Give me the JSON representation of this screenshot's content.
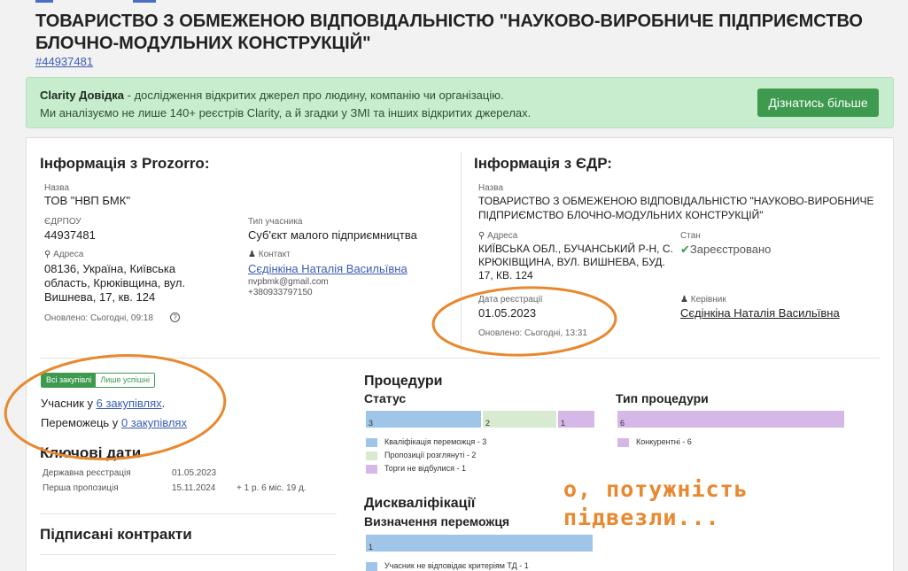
{
  "company": {
    "title": "ТОВАРИСТВО З ОБМЕЖЕНОЮ ВІДПОВІДАЛЬНІСТЮ \"НАУКОВО-ВИРОБНИЧЕ ПІДПРИЄМСТВО БЛОЧНО-МОДУЛЬНИХ КОНСТРУКЦІЙ\"",
    "id_link": "#44937481"
  },
  "banner": {
    "brand": "Clarity Довідка",
    "line1": " - дослідження відкритих джерел про людину, компанію чи організацію.",
    "line2": "Ми аналізуємо не лише 140+ реєстрів Clarity, а й згадки у ЗМІ та інших відкритих джерелах.",
    "button": "Дізнатись більше",
    "bg_color": "#c8ecce",
    "button_color": "#3d9a4e"
  },
  "prozorro": {
    "heading": "Інформація з Prozorro:",
    "name_label": "Назва",
    "name": "ТОВ \"НВП БМК\"",
    "edrpou_label": "ЄДРПОУ",
    "edrpou": "44937481",
    "participant_type_label": "Тип учасника",
    "participant_type": "Суб'єкт малого підприємництва",
    "address_label": "Адреса",
    "address": "08136, Україна, Київська область, Крюківщина, вул. Вишнева, 17, кв. 124",
    "contact_label": "Контакт",
    "contact_name": "Сєдінкіна Наталія Васильївна",
    "contact_email": "nvpbmk@gmail.com",
    "contact_phone": "+380933797150",
    "updated": "Оновлено: Сьогодні, 09:18",
    "help_icon": "question-circle-icon"
  },
  "edr": {
    "heading": "Інформація з ЄДР:",
    "name_label": "Назва",
    "name": "ТОВАРИСТВО З ОБМЕЖЕНОЮ ВІДПОВІДАЛЬНІСТЮ \"НАУКОВО-ВИРОБНИЧЕ ПІДПРИЄМСТВО БЛОЧНО-МОДУЛЬНИХ КОНСТРУКЦІЙ\"",
    "address_label": "Адреса",
    "address": "КИЇВСЬКА ОБЛ., БУЧАНСЬКИЙ Р-Н, С. КРЮКІВЩИНА, ВУЛ. ВИШНЕВА, БУД. 17, КВ. 124",
    "status_label": "Стан",
    "status": "Зареєстровано",
    "reg_date_label": "Дата реєстрації",
    "reg_date": "01.05.2023",
    "head_label": "Керівник",
    "head_name": "Сєдінкіна Наталія Васильївна",
    "updated": "Оновлено: Сьогодні, 13:31"
  },
  "purchases": {
    "toggle_all": "Всі закупівлі",
    "toggle_success": "Лише успішні",
    "participant_prefix": "Учасник у ",
    "participant_link": "6 закупівлях",
    "participant_suffix": ".",
    "winner_prefix": "Переможець у ",
    "winner_link": "0 закупівлях"
  },
  "key_dates": {
    "heading": "Ключові дати",
    "rows": [
      {
        "label": "Державна реєстрація",
        "value": "01.05.2023",
        "extra": ""
      },
      {
        "label": "Перша пропозиція",
        "value": "15.11.2024",
        "extra": "+ 1 р. 6 міс. 19 д."
      }
    ]
  },
  "contracts": {
    "heading": "Підписані контракти"
  },
  "procedures": {
    "heading": "Процедури",
    "status_title": "Статус",
    "status_bars": [
      {
        "value": "3",
        "color": "#9fc5e8"
      },
      {
        "value": "2",
        "color": "#d9ead3"
      },
      {
        "value": "1",
        "color": "#d5b8e8"
      }
    ],
    "status_legend": [
      {
        "label": "Кваліфікація переможця - 3",
        "color": "#9fc5e8"
      },
      {
        "label": "Пропозиції розглянуті - 2",
        "color": "#d9ead3"
      },
      {
        "label": "Торги не відбулися - 1",
        "color": "#d5b8e8"
      }
    ],
    "type_title": "Тип процедури",
    "type_bar": {
      "value": "6",
      "color": "#d5b8e8"
    },
    "type_legend": [
      {
        "label": "Конкурентні - 6",
        "color": "#d5b8e8"
      }
    ]
  },
  "disqualifications": {
    "heading": "Дискваліфікації",
    "sub": "Визначення переможця",
    "bar": {
      "value": "1",
      "color": "#9fc5e8"
    },
    "legend": [
      {
        "label": "Учасник не відповідає критеріям ТД - 1",
        "color": "#9fc5e8"
      }
    ]
  },
  "annotation": {
    "line1": "о, потужність",
    "line2": "підвезли...",
    "color": "#e8882f"
  }
}
